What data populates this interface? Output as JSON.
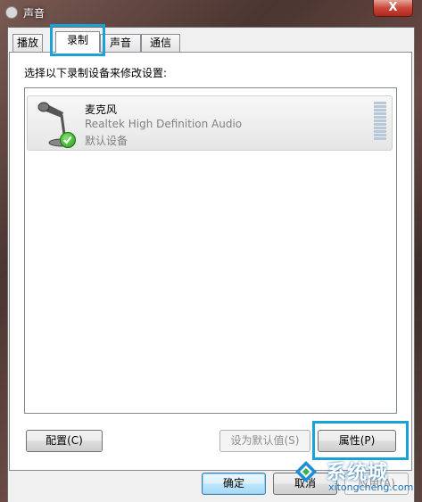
{
  "window": {
    "title": "声音",
    "close_label": "X"
  },
  "tabs": [
    {
      "label": "播放",
      "active": false
    },
    {
      "label": "录制",
      "active": true
    },
    {
      "label": "声音",
      "active": false
    },
    {
      "label": "通信",
      "active": false
    }
  ],
  "instruction": "选择以下录制设备来修改设置:",
  "device": {
    "name": "麦克风",
    "description": "Realtek High Definition Audio",
    "status": "默认设备",
    "icon": "microphone-icon",
    "status_icon": "green-check-icon"
  },
  "buttons": {
    "configure": "配置(C)",
    "set_default": "设为默认值(S)",
    "properties": "属性(P)",
    "ok": "确定",
    "cancel": "取消",
    "apply": "应用(A)"
  },
  "watermark": {
    "text": "系统城",
    "url": "xitongcheng.com"
  },
  "colors": {
    "highlight": "#1aa1d8",
    "close": "#c9473a"
  }
}
